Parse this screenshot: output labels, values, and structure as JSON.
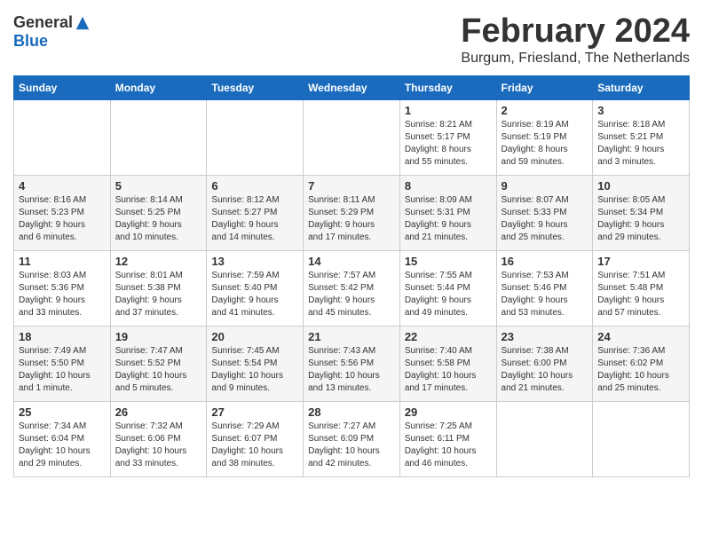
{
  "logo": {
    "general": "General",
    "blue": "Blue"
  },
  "title": {
    "month": "February 2024",
    "location": "Burgum, Friesland, The Netherlands"
  },
  "header": {
    "days": [
      "Sunday",
      "Monday",
      "Tuesday",
      "Wednesday",
      "Thursday",
      "Friday",
      "Saturday"
    ]
  },
  "weeks": [
    {
      "cells": [
        {
          "day": "",
          "info": ""
        },
        {
          "day": "",
          "info": ""
        },
        {
          "day": "",
          "info": ""
        },
        {
          "day": "",
          "info": ""
        },
        {
          "day": "1",
          "info": "Sunrise: 8:21 AM\nSunset: 5:17 PM\nDaylight: 8 hours\nand 55 minutes."
        },
        {
          "day": "2",
          "info": "Sunrise: 8:19 AM\nSunset: 5:19 PM\nDaylight: 8 hours\nand 59 minutes."
        },
        {
          "day": "3",
          "info": "Sunrise: 8:18 AM\nSunset: 5:21 PM\nDaylight: 9 hours\nand 3 minutes."
        }
      ]
    },
    {
      "cells": [
        {
          "day": "4",
          "info": "Sunrise: 8:16 AM\nSunset: 5:23 PM\nDaylight: 9 hours\nand 6 minutes."
        },
        {
          "day": "5",
          "info": "Sunrise: 8:14 AM\nSunset: 5:25 PM\nDaylight: 9 hours\nand 10 minutes."
        },
        {
          "day": "6",
          "info": "Sunrise: 8:12 AM\nSunset: 5:27 PM\nDaylight: 9 hours\nand 14 minutes."
        },
        {
          "day": "7",
          "info": "Sunrise: 8:11 AM\nSunset: 5:29 PM\nDaylight: 9 hours\nand 17 minutes."
        },
        {
          "day": "8",
          "info": "Sunrise: 8:09 AM\nSunset: 5:31 PM\nDaylight: 9 hours\nand 21 minutes."
        },
        {
          "day": "9",
          "info": "Sunrise: 8:07 AM\nSunset: 5:33 PM\nDaylight: 9 hours\nand 25 minutes."
        },
        {
          "day": "10",
          "info": "Sunrise: 8:05 AM\nSunset: 5:34 PM\nDaylight: 9 hours\nand 29 minutes."
        }
      ]
    },
    {
      "cells": [
        {
          "day": "11",
          "info": "Sunrise: 8:03 AM\nSunset: 5:36 PM\nDaylight: 9 hours\nand 33 minutes."
        },
        {
          "day": "12",
          "info": "Sunrise: 8:01 AM\nSunset: 5:38 PM\nDaylight: 9 hours\nand 37 minutes."
        },
        {
          "day": "13",
          "info": "Sunrise: 7:59 AM\nSunset: 5:40 PM\nDaylight: 9 hours\nand 41 minutes."
        },
        {
          "day": "14",
          "info": "Sunrise: 7:57 AM\nSunset: 5:42 PM\nDaylight: 9 hours\nand 45 minutes."
        },
        {
          "day": "15",
          "info": "Sunrise: 7:55 AM\nSunset: 5:44 PM\nDaylight: 9 hours\nand 49 minutes."
        },
        {
          "day": "16",
          "info": "Sunrise: 7:53 AM\nSunset: 5:46 PM\nDaylight: 9 hours\nand 53 minutes."
        },
        {
          "day": "17",
          "info": "Sunrise: 7:51 AM\nSunset: 5:48 PM\nDaylight: 9 hours\nand 57 minutes."
        }
      ]
    },
    {
      "cells": [
        {
          "day": "18",
          "info": "Sunrise: 7:49 AM\nSunset: 5:50 PM\nDaylight: 10 hours\nand 1 minute."
        },
        {
          "day": "19",
          "info": "Sunrise: 7:47 AM\nSunset: 5:52 PM\nDaylight: 10 hours\nand 5 minutes."
        },
        {
          "day": "20",
          "info": "Sunrise: 7:45 AM\nSunset: 5:54 PM\nDaylight: 10 hours\nand 9 minutes."
        },
        {
          "day": "21",
          "info": "Sunrise: 7:43 AM\nSunset: 5:56 PM\nDaylight: 10 hours\nand 13 minutes."
        },
        {
          "day": "22",
          "info": "Sunrise: 7:40 AM\nSunset: 5:58 PM\nDaylight: 10 hours\nand 17 minutes."
        },
        {
          "day": "23",
          "info": "Sunrise: 7:38 AM\nSunset: 6:00 PM\nDaylight: 10 hours\nand 21 minutes."
        },
        {
          "day": "24",
          "info": "Sunrise: 7:36 AM\nSunset: 6:02 PM\nDaylight: 10 hours\nand 25 minutes."
        }
      ]
    },
    {
      "cells": [
        {
          "day": "25",
          "info": "Sunrise: 7:34 AM\nSunset: 6:04 PM\nDaylight: 10 hours\nand 29 minutes."
        },
        {
          "day": "26",
          "info": "Sunrise: 7:32 AM\nSunset: 6:06 PM\nDaylight: 10 hours\nand 33 minutes."
        },
        {
          "day": "27",
          "info": "Sunrise: 7:29 AM\nSunset: 6:07 PM\nDaylight: 10 hours\nand 38 minutes."
        },
        {
          "day": "28",
          "info": "Sunrise: 7:27 AM\nSunset: 6:09 PM\nDaylight: 10 hours\nand 42 minutes."
        },
        {
          "day": "29",
          "info": "Sunrise: 7:25 AM\nSunset: 6:11 PM\nDaylight: 10 hours\nand 46 minutes."
        },
        {
          "day": "",
          "info": ""
        },
        {
          "day": "",
          "info": ""
        }
      ]
    }
  ]
}
